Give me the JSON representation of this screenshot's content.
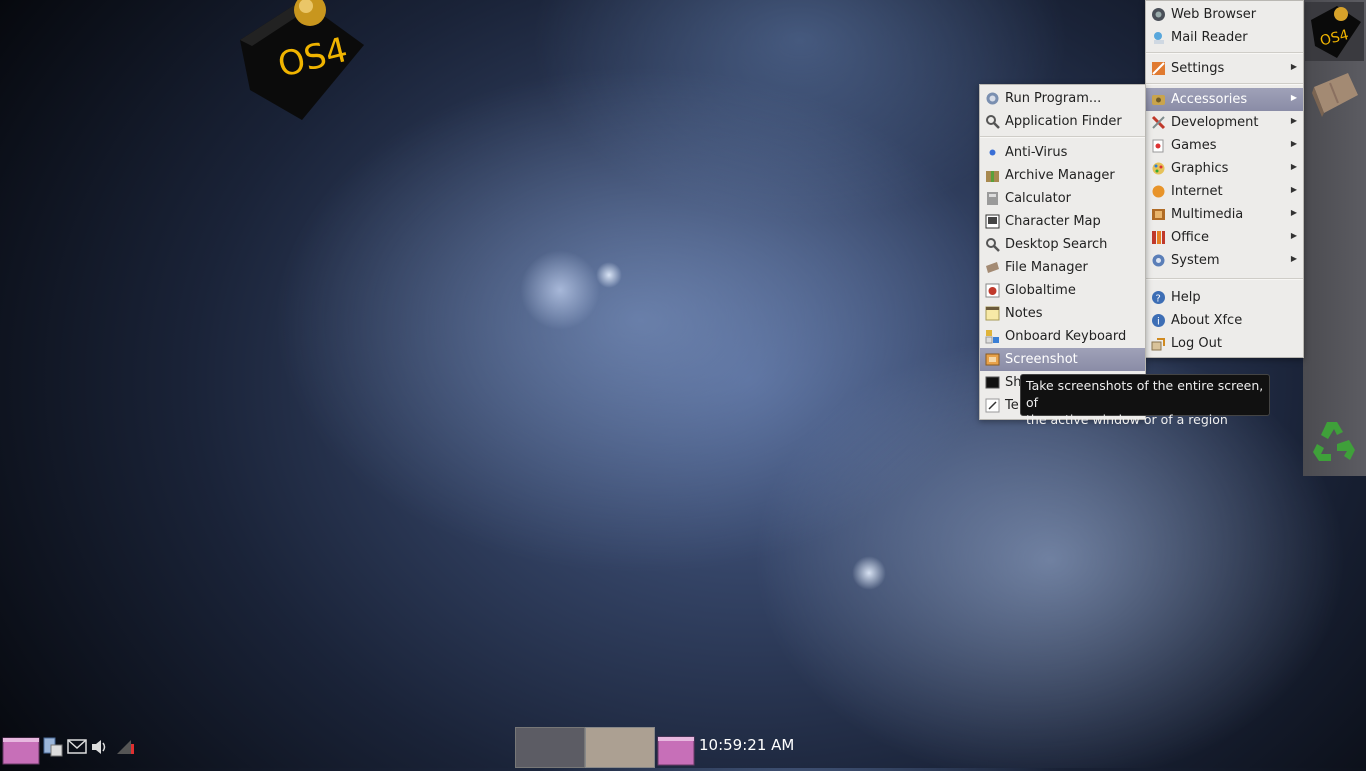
{
  "desktop": {
    "logo_text": "OS4",
    "logo_icon": "os4-cube-logo"
  },
  "dock": {
    "items": [
      {
        "name": "os4-menu",
        "icon": "os4-cube-icon"
      },
      {
        "name": "file-manager",
        "icon": "folder-icon"
      },
      {
        "name": "trash",
        "icon": "recycle-icon"
      }
    ]
  },
  "main_menu": {
    "items": [
      {
        "label": "Web Browser",
        "icon": "globe-icon",
        "submenu": false
      },
      {
        "label": "Mail Reader",
        "icon": "mail-icon",
        "submenu": false
      },
      {
        "label": "Settings",
        "icon": "settings-icon",
        "submenu": true
      },
      {
        "label": "Accessories",
        "icon": "accessories-icon",
        "submenu": true,
        "highlighted": true
      },
      {
        "label": "Development",
        "icon": "development-icon",
        "submenu": true
      },
      {
        "label": "Games",
        "icon": "games-icon",
        "submenu": true
      },
      {
        "label": "Graphics",
        "icon": "graphics-icon",
        "submenu": true
      },
      {
        "label": "Internet",
        "icon": "internet-icon",
        "submenu": true
      },
      {
        "label": "Multimedia",
        "icon": "multimedia-icon",
        "submenu": true
      },
      {
        "label": "Office",
        "icon": "office-icon",
        "submenu": true
      },
      {
        "label": "System",
        "icon": "system-icon",
        "submenu": true
      },
      {
        "label": "Help",
        "icon": "help-icon",
        "submenu": false
      },
      {
        "label": "About Xfce",
        "icon": "info-icon",
        "submenu": false
      },
      {
        "label": "Log Out",
        "icon": "logout-icon",
        "submenu": false
      }
    ]
  },
  "accessories_menu": {
    "items": [
      {
        "label": "Run Program...",
        "icon": "run-icon"
      },
      {
        "label": "Application Finder",
        "icon": "search-icon"
      },
      {
        "label": "Anti-Virus",
        "icon": "antivirus-icon"
      },
      {
        "label": "Archive Manager",
        "icon": "archive-icon"
      },
      {
        "label": "Calculator",
        "icon": "calculator-icon"
      },
      {
        "label": "Character Map",
        "icon": "charmap-icon"
      },
      {
        "label": "Desktop Search",
        "icon": "search-icon"
      },
      {
        "label": "File Manager",
        "icon": "folder-icon"
      },
      {
        "label": "Globaltime",
        "icon": "clock-icon"
      },
      {
        "label": "Notes",
        "icon": "notes-icon"
      },
      {
        "label": "Onboard Keyboard",
        "icon": "keyboard-icon"
      },
      {
        "label": "Screenshot",
        "icon": "screenshot-icon",
        "highlighted": true
      },
      {
        "label": "Sh",
        "icon": "terminal-icon"
      },
      {
        "label": "Te",
        "icon": "text-editor-icon"
      }
    ]
  },
  "tooltip": {
    "line1": "Take screenshots of the entire screen, of",
    "line2": "the active window or of a region"
  },
  "panel": {
    "clock": "10:59:21 AM",
    "tray_icons": [
      "clipboard-icon",
      "mail-icon",
      "volume-icon",
      "network-icon"
    ]
  }
}
